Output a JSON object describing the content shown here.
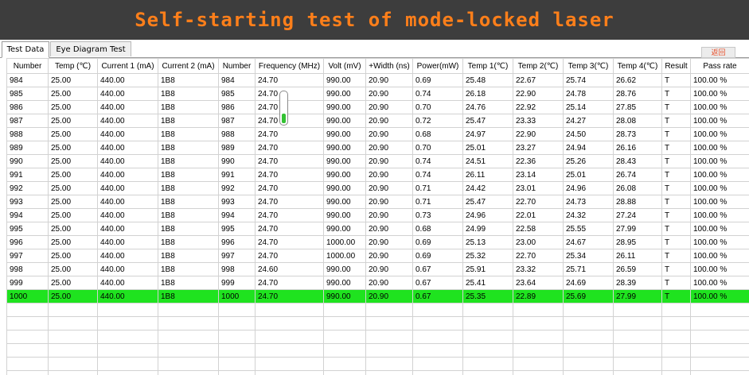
{
  "window": {
    "title": "Self-starting test of mode-locked laser"
  },
  "tabs": [
    {
      "label": "Test Data",
      "active": true
    },
    {
      "label": "Eye Diagram Test",
      "active": false
    }
  ],
  "return_button": {
    "label": "返回"
  },
  "colors": {
    "title_bg": "#3d3d3d",
    "title_text": "#ff7f1a",
    "highlight_row": "#1fe31f",
    "return_text": "#e8502a"
  },
  "table": {
    "columns": [
      "Number",
      "Temp (℃)",
      "Current 1 (mA)",
      "Current 2 (mA)",
      "Number",
      "Frequency (MHz)",
      "Volt (mV)",
      "+Width (ns)",
      "Power(mW)",
      "Temp 1(℃)",
      "Temp 2(℃)",
      "Temp 3(℃)",
      "Temp 4(℃)",
      "Result",
      "Pass rate"
    ],
    "rows": [
      [
        "984",
        "25.00",
        "440.00",
        "1B8",
        "984",
        "24.70",
        "990.00",
        "20.90",
        "0.69",
        "25.48",
        "22.67",
        "25.74",
        "26.62",
        "T",
        "100.00 %"
      ],
      [
        "985",
        "25.00",
        "440.00",
        "1B8",
        "985",
        "24.70",
        "990.00",
        "20.90",
        "0.74",
        "26.18",
        "22.90",
        "24.78",
        "28.76",
        "T",
        "100.00 %"
      ],
      [
        "986",
        "25.00",
        "440.00",
        "1B8",
        "986",
        "24.70",
        "990.00",
        "20.90",
        "0.70",
        "24.76",
        "22.92",
        "25.14",
        "27.85",
        "T",
        "100.00 %"
      ],
      [
        "987",
        "25.00",
        "440.00",
        "1B8",
        "987",
        "24.70",
        "990.00",
        "20.90",
        "0.72",
        "25.47",
        "23.33",
        "24.27",
        "28.08",
        "T",
        "100.00 %"
      ],
      [
        "988",
        "25.00",
        "440.00",
        "1B8",
        "988",
        "24.70",
        "990.00",
        "20.90",
        "0.68",
        "24.97",
        "22.90",
        "24.50",
        "28.73",
        "T",
        "100.00 %"
      ],
      [
        "989",
        "25.00",
        "440.00",
        "1B8",
        "989",
        "24.70",
        "990.00",
        "20.90",
        "0.70",
        "25.01",
        "23.27",
        "24.94",
        "26.16",
        "T",
        "100.00 %"
      ],
      [
        "990",
        "25.00",
        "440.00",
        "1B8",
        "990",
        "24.70",
        "990.00",
        "20.90",
        "0.74",
        "24.51",
        "22.36",
        "25.26",
        "28.43",
        "T",
        "100.00 %"
      ],
      [
        "991",
        "25.00",
        "440.00",
        "1B8",
        "991",
        "24.70",
        "990.00",
        "20.90",
        "0.74",
        "26.11",
        "23.14",
        "25.01",
        "26.74",
        "T",
        "100.00 %"
      ],
      [
        "992",
        "25.00",
        "440.00",
        "1B8",
        "992",
        "24.70",
        "990.00",
        "20.90",
        "0.71",
        "24.42",
        "23.01",
        "24.96",
        "26.08",
        "T",
        "100.00 %"
      ],
      [
        "993",
        "25.00",
        "440.00",
        "1B8",
        "993",
        "24.70",
        "990.00",
        "20.90",
        "0.71",
        "25.47",
        "22.70",
        "24.73",
        "28.88",
        "T",
        "100.00 %"
      ],
      [
        "994",
        "25.00",
        "440.00",
        "1B8",
        "994",
        "24.70",
        "990.00",
        "20.90",
        "0.73",
        "24.96",
        "22.01",
        "24.32",
        "27.24",
        "T",
        "100.00 %"
      ],
      [
        "995",
        "25.00",
        "440.00",
        "1B8",
        "995",
        "24.70",
        "990.00",
        "20.90",
        "0.68",
        "24.99",
        "22.58",
        "25.55",
        "27.99",
        "T",
        "100.00 %"
      ],
      [
        "996",
        "25.00",
        "440.00",
        "1B8",
        "996",
        "24.70",
        "1000.00",
        "20.90",
        "0.69",
        "25.13",
        "23.00",
        "24.67",
        "28.95",
        "T",
        "100.00 %"
      ],
      [
        "997",
        "25.00",
        "440.00",
        "1B8",
        "997",
        "24.70",
        "1000.00",
        "20.90",
        "0.69",
        "25.32",
        "22.70",
        "25.34",
        "26.11",
        "T",
        "100.00 %"
      ],
      [
        "998",
        "25.00",
        "440.00",
        "1B8",
        "998",
        "24.60",
        "990.00",
        "20.90",
        "0.67",
        "25.91",
        "23.32",
        "25.71",
        "26.59",
        "T",
        "100.00 %"
      ],
      [
        "999",
        "25.00",
        "440.00",
        "1B8",
        "999",
        "24.70",
        "990.00",
        "20.90",
        "0.67",
        "25.41",
        "23.64",
        "24.69",
        "28.39",
        "T",
        "100.00 %"
      ],
      [
        "1000",
        "25.00",
        "440.00",
        "1B8",
        "1000",
        "24.70",
        "990.00",
        "20.90",
        "0.67",
        "25.35",
        "22.89",
        "25.69",
        "27.99",
        "T",
        "100.00 %"
      ]
    ],
    "highlighted_row": 16,
    "empty_rows": 6
  }
}
